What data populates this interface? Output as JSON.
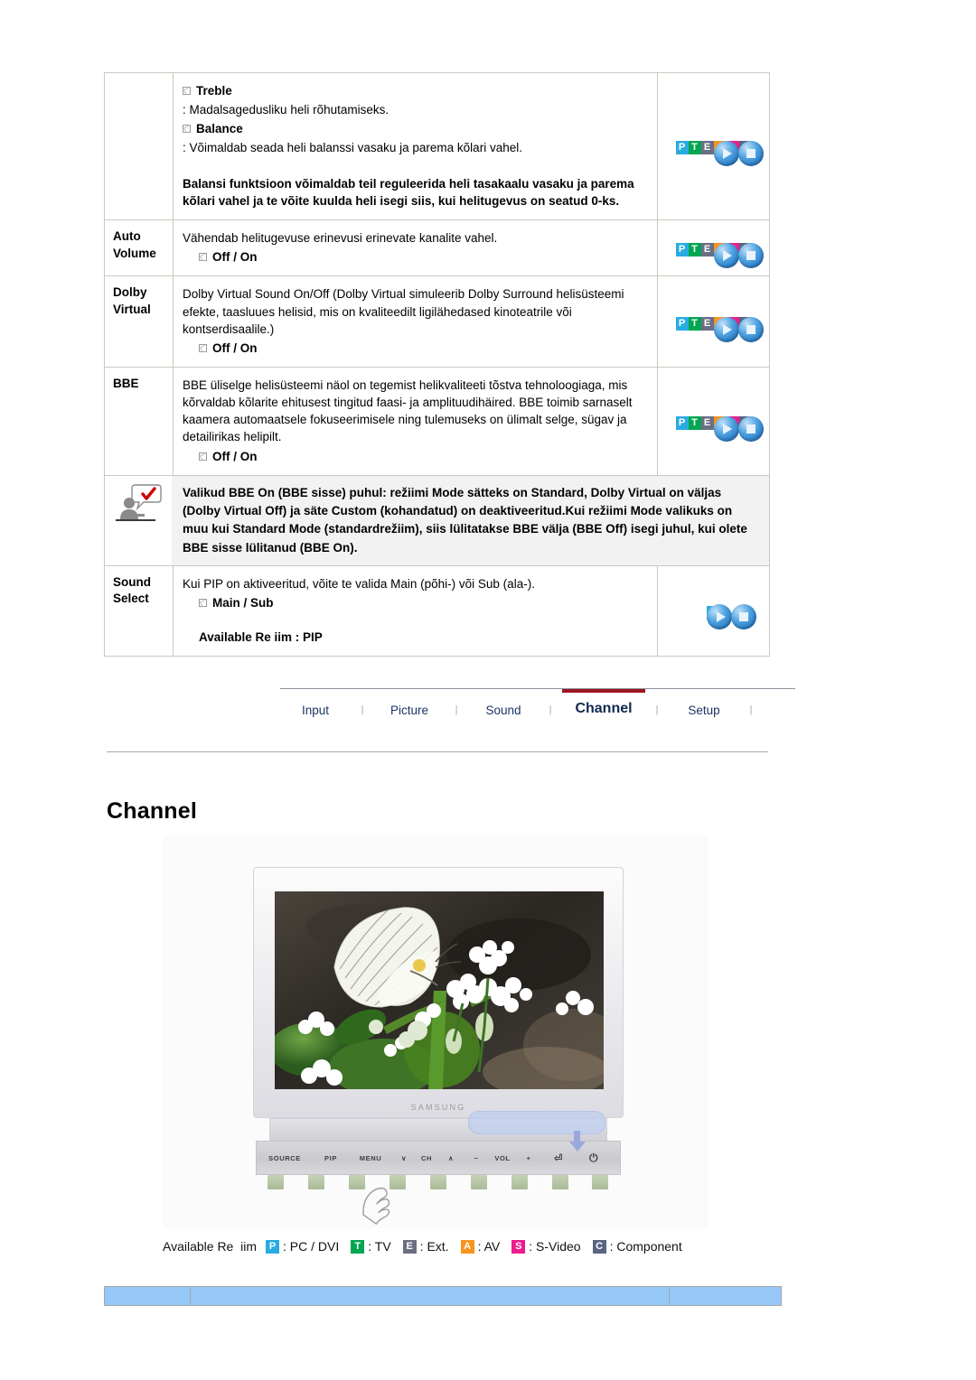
{
  "colors": {
    "accent_red": "#9c1521",
    "nav_text": "#1b3464",
    "badge_p": "#29abe2",
    "badge_t": "#00a650",
    "badge_e": "#6b6f85",
    "badge_a": "#f7941e",
    "badge_s": "#ec1c8e",
    "badge_c": "#5a6380",
    "note_bg": "#f2f2f2",
    "bottom_bar": "#96c8f8"
  },
  "spec_table": {
    "rows": [
      {
        "label": "",
        "bullets": [
          {
            "marker": "checkbox",
            "title": "Treble",
            "desc": ": Madalsagedusliku heli rõhutamiseks."
          },
          {
            "marker": "checkbox",
            "title": "Balance",
            "desc": ": Võimaldab seada heli balanssi vasaku ja parema kõlari vahel."
          }
        ],
        "bold_note": "Balansi funktsioon võimaldab teil reguleerida heli tasakaalu vasaku ja parema kõlari vahel ja te võite kuulda heli isegi siis, kui helitugevus on seatud 0-ks.",
        "icon": "pteasc"
      },
      {
        "label": "Auto Volume",
        "lead": "Vähendab helitugevuse erinevusi erinevate kanalite vahel.",
        "option": "Off / On",
        "icon": "pteasc"
      },
      {
        "label": "Dolby Virtual",
        "lead": "Dolby Virtual Sound On/Off (Dolby Virtual simuleerib Dolby Surround helisüsteemi efekte, taasluues helisid, mis on kvaliteedilt ligilähedased kinoteatrile või kontserdisaalile.)",
        "option": "Off / On",
        "icon": "pteasc"
      },
      {
        "label": "BBE",
        "lead": "BBE üliselge helisüsteemi näol on tegemist helikvaliteeti tõstva tehnoloogiaga, mis kõrvaldab kõlarite ehitusest tingitud faasi- ja amplituudihäired. BBE toimib sarnaselt kaamera automaatsele fokuseerimisele ning tulemuseks on ülimalt selge, sügav ja detailirikas helipilt.",
        "option": "Off / On",
        "icon": "pteasc"
      }
    ],
    "note": {
      "icon": "note-person-icon",
      "text": "Valikud BBE On (BBE sisse) puhul: režiimi Mode sätteks on Standard, Dolby Virtual on väljas (Dolby Virtual Off) ja säte Custom (kohandatud) on deaktiveeritud.Kui režiimi Mode valikuks on muu kui Standard Mode (standardrežiim), siis lülitatakse BBE välja (BBE Off) isegi juhul, kui olete BBE sisse lülitanud (BBE On)."
    },
    "sound_select": {
      "label": "Sound Select",
      "lead": "Kui PIP on aktiveeritud, võite te valida Main (põhi-) või Sub (ala-).",
      "option": "Main / Sub",
      "available": "Available Re  iim : PIP",
      "icon": "single-p"
    }
  },
  "nav": {
    "items": [
      {
        "label": "Input",
        "active": false
      },
      {
        "label": "Picture",
        "active": false
      },
      {
        "label": "Sound",
        "active": false
      },
      {
        "label": "Channel",
        "active": true
      },
      {
        "label": "Setup",
        "active": false
      }
    ],
    "separator": "|"
  },
  "section": {
    "title": "Channel"
  },
  "figure": {
    "brand": "SAMSUNG",
    "panel_buttons": [
      "SOURCE",
      "PIP",
      "MENU",
      "∨",
      "CH",
      "∧",
      "−",
      "VOL",
      "+",
      "⏎",
      "⏻"
    ],
    "screen_content": "butterfly-on-white-flowers-photo"
  },
  "legend": {
    "label": "Available Re  iim",
    "items": [
      {
        "badge": "P",
        "color": "#29abe2",
        "text": ": PC / DVI"
      },
      {
        "badge": "T",
        "color": "#00a650",
        "text": ": TV"
      },
      {
        "badge": "E",
        "color": "#6b6f85",
        "text": ": Ext."
      },
      {
        "badge": "A",
        "color": "#f7941e",
        "text": ": AV"
      },
      {
        "badge": "S",
        "color": "#ec1c8e",
        "text": ": S-Video"
      },
      {
        "badge": "C",
        "color": "#5a6380",
        "text": ": Component"
      }
    ]
  },
  "pteasc_icon": {
    "cells": [
      {
        "letter": "P",
        "color": "#29abe2"
      },
      {
        "letter": "T",
        "color": "#00a650"
      },
      {
        "letter": "E",
        "color": "#6b6f85"
      },
      {
        "letter": "A",
        "color": "#f7941e"
      },
      {
        "letter": "S",
        "color": "#ec1c8e"
      },
      {
        "letter": "C",
        "color": "#5a6380"
      }
    ]
  },
  "bottom_bar": {
    "segments": [
      95,
      530,
      123
    ]
  }
}
